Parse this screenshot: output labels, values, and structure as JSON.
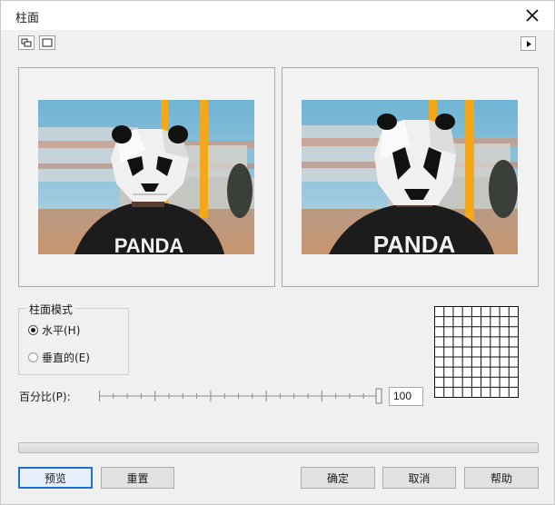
{
  "window": {
    "title": "柱面"
  },
  "icons": {
    "close": "close-icon",
    "view_split": "split-view-icon",
    "view_single": "single-view-icon",
    "expand": "triangle-right-icon"
  },
  "mode_group": {
    "label": "柱面模式",
    "options": [
      {
        "label": "水平(H)",
        "mnemonic": "H",
        "selected": true
      },
      {
        "label": "垂直的(E)",
        "mnemonic": "E",
        "selected": false
      }
    ]
  },
  "percent": {
    "label": "百分比(P):",
    "value": "100",
    "min": 0,
    "max": 100
  },
  "buttons": {
    "preview": "预览",
    "reset": "重置",
    "ok": "确定",
    "cancel": "取消",
    "help": "帮助"
  },
  "images": {
    "original": {
      "shirt_text": "PANDA"
    },
    "result": {
      "shirt_text": "PANDA"
    }
  },
  "colors": {
    "focus_border": "#1f6fd1",
    "sky": "#8fc0d8",
    "pole": "#f2a81a",
    "shirt": "#1c1c1c"
  }
}
